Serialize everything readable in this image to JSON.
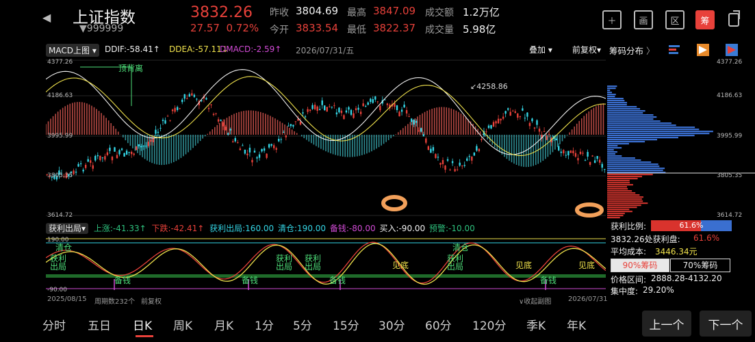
{
  "header": {
    "title": "上证指数",
    "code": "999999",
    "price": "3832.26",
    "change": "27.57",
    "change_pct": "0.72%",
    "quotes": [
      {
        "label": "昨收",
        "value": "3804.69",
        "color": "white"
      },
      {
        "label": "最高",
        "value": "3847.09",
        "color": "red"
      },
      {
        "label": "成交额",
        "value": "1.2万亿",
        "color": "white"
      },
      {
        "label": "今开",
        "value": "3833.54",
        "color": "red"
      },
      {
        "label": "最低",
        "value": "3822.37",
        "color": "red"
      },
      {
        "label": "成交量",
        "value": "5.98亿",
        "color": "white"
      }
    ],
    "tools": [
      "plus-icon",
      "picture-icon",
      "zone-icon",
      "chip-icon",
      "share-icon"
    ],
    "tool_labels": {
      "picture": "画",
      "zone": "区",
      "chip": "筹"
    }
  },
  "indicator_bar": {
    "macd_select": "MACD上图",
    "ddif": "DDIF:-58.41↑",
    "ddea": "DDEA:-57.11↓",
    "dmacd": "DMACD:-2.59↑",
    "date": "2026/07/31/五",
    "overlay": "叠加",
    "adjust": "前复权",
    "chip_tab": "筹码分布"
  },
  "main_chart": {
    "y_labels": [
      "4377.26",
      "4186.63",
      "3995.99",
      "3805.35",
      "3614.72"
    ],
    "annotations": {
      "peak_divergence": "顶背离",
      "high_mark": "4258.86"
    }
  },
  "chip_axis": [
    "4377.26",
    "4186.63",
    "3995.99",
    "3805.35",
    "3614.72"
  ],
  "lower_indicator": {
    "name": "获利出局",
    "up": "上涨:-41.33↑",
    "down": "下跌:-42.41↑",
    "exit": "获利出局:160.00",
    "clear": "清仓:190.00",
    "reserve": "备钱:-80.00",
    "buy": "买入:-90.00",
    "warn": "预警:-10.00",
    "axis_top": "190.00",
    "axis_bottom": "-90.00",
    "labels": {
      "clear": "清仓",
      "profit": "获利",
      "exit": "出局",
      "reserve": "备钱",
      "bottom": "见底"
    }
  },
  "chip_info": {
    "profit_ratio_label": "获利比例:",
    "profit_ratio": "61.6%",
    "profit_ratio_value": 0.616,
    "at_price_label": "3832.26处获利盘:",
    "at_price_value": "61.6%",
    "avg_cost_label": "平均成本:",
    "avg_cost": "3446.34元",
    "btn_90": "90%筹码",
    "btn_70": "70%筹码",
    "range_label": "价格区间:",
    "range": "2888.28-4132.20",
    "concentration_label": "集中度:",
    "concentration": "29.20%"
  },
  "footer_info": {
    "start_date": "2025/08/15",
    "period": "周期数232个",
    "adjust": "前复权",
    "collapse": "收起副图",
    "end_date": "2026/07/31"
  },
  "periods": [
    "分时",
    "五日",
    "日K",
    "周K",
    "月K",
    "1分",
    "5分",
    "15分",
    "30分",
    "60分",
    "120分",
    "季K",
    "年K"
  ],
  "nav": {
    "prev": "上一个",
    "next": "下一个"
  },
  "colors": {
    "up": "#e8413a",
    "down": "#34d6e6",
    "accent": "#e8413a",
    "ma_yellow": "#f0e24c"
  }
}
